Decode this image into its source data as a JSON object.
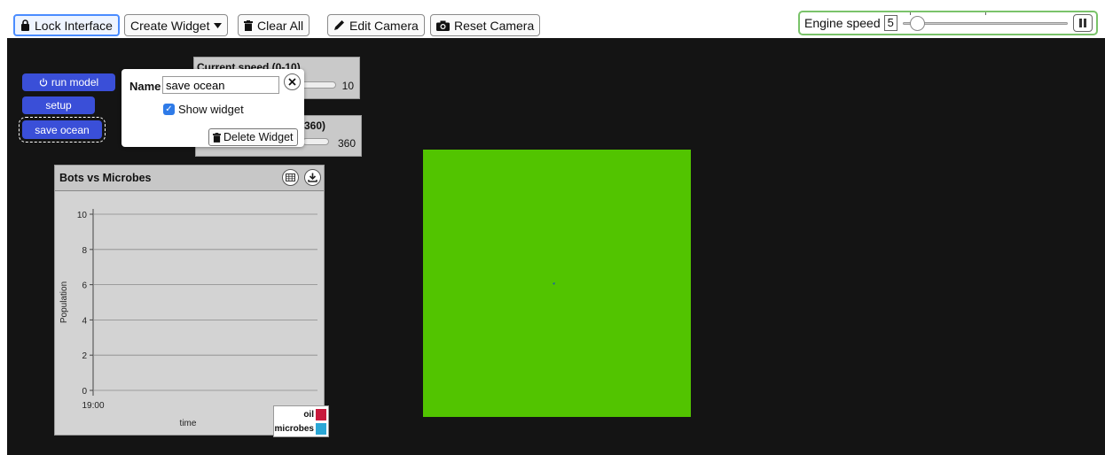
{
  "toolbar": {
    "lock_label": "Lock Interface",
    "create_label": "Create Widget",
    "clear_label": "Clear All",
    "edit_camera_label": "Edit Camera",
    "reset_camera_label": "Reset Camera"
  },
  "engine": {
    "label": "Engine speed",
    "value": "5",
    "slider_fraction": 0.05
  },
  "widgets": {
    "run_label": "run model",
    "setup_label": "setup",
    "save_label": "save ocean",
    "speed_slider": {
      "title": "Current speed (0-10)",
      "value": "10",
      "fraction": 1.0
    },
    "heading_slider": {
      "title": "360)",
      "value": "360",
      "fraction": 1.0
    }
  },
  "popup": {
    "name_label": "Name",
    "name_value": "save ocean",
    "show_label": "Show widget",
    "delete_label": "Delete Widget"
  },
  "plot": {
    "title": "Bots vs Microbes",
    "xlabel": "time",
    "ylabel": "Population",
    "x_tick": "19:00",
    "legend": [
      {
        "name": "oil",
        "color": "#c8193c"
      },
      {
        "name": "microbes",
        "color": "#2aa7d6"
      }
    ]
  },
  "chart_data": {
    "type": "line",
    "title": "Bots vs Microbes",
    "xlabel": "time",
    "ylabel": "Population",
    "ylim": [
      0,
      10
    ],
    "yticks": [
      0,
      2,
      4,
      6,
      8,
      10
    ],
    "xticks": [
      "19:00"
    ],
    "grid": true,
    "legend_placement": "bottom-right",
    "series": [
      {
        "name": "oil",
        "color": "#c8193c",
        "values": []
      },
      {
        "name": "microbes",
        "color": "#2aa7d6",
        "values": []
      }
    ]
  },
  "world": {
    "color": "#52c400"
  },
  "colors": {
    "accent": "#3a4fd8",
    "stage": "#141414",
    "engine_border": "#7ac36a"
  }
}
